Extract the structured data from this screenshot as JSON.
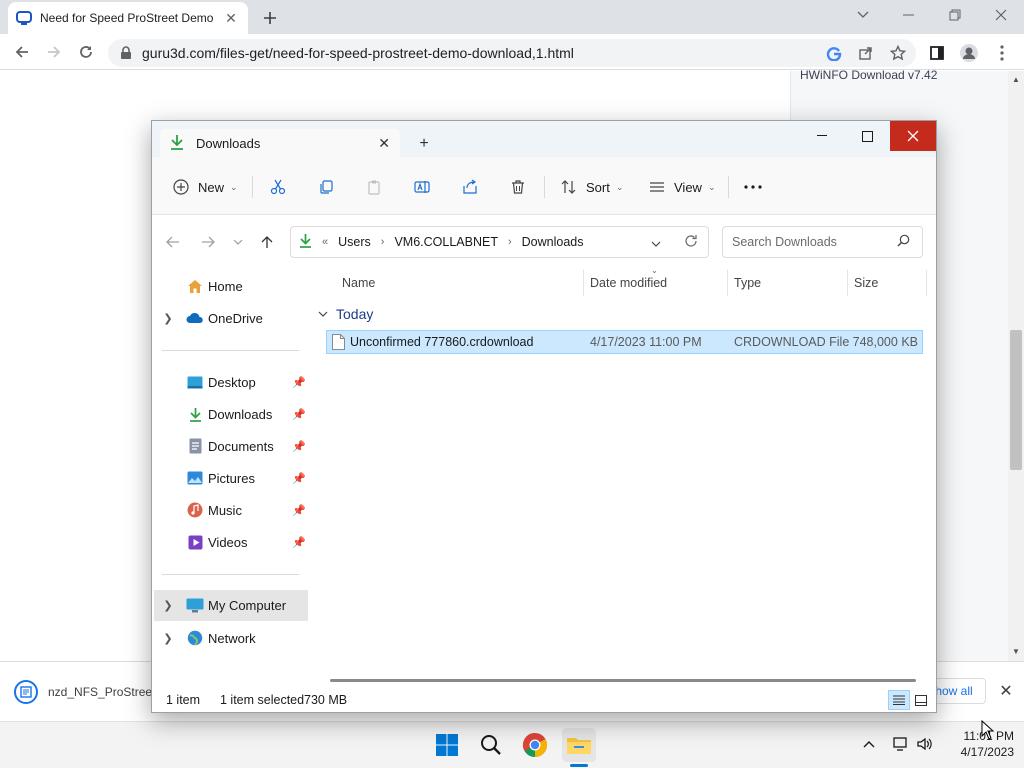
{
  "chrome": {
    "tab_title": "Need for Speed ProStreet Demo",
    "url": "guru3d.com/files-get/need-for-speed-prostreet-demo-download,1.html"
  },
  "page": {
    "sidebar_link": "HWiNFO Download v7.42"
  },
  "download_bar": {
    "filename": "nzd_NFS_ProStree",
    "show_all": "how all"
  },
  "explorer": {
    "tab_title": "Downloads",
    "commands": {
      "new": "New",
      "sort": "Sort",
      "view": "View"
    },
    "breadcrumb": {
      "prefix": "«",
      "items": [
        "Users",
        "VM6.COLLABNET",
        "Downloads"
      ]
    },
    "search_placeholder": "Search Downloads",
    "nav": {
      "home": "Home",
      "onedrive": "OneDrive",
      "desktop": "Desktop",
      "downloads": "Downloads",
      "documents": "Documents",
      "pictures": "Pictures",
      "music": "Music",
      "videos": "Videos",
      "my_computer": "My Computer",
      "network": "Network"
    },
    "columns": {
      "name": "Name",
      "date": "Date modified",
      "type": "Type",
      "size": "Size"
    },
    "group": "Today",
    "files": [
      {
        "name": "Unconfirmed 777860.crdownload",
        "date": "4/17/2023 11:00 PM",
        "type": "CRDOWNLOAD File",
        "size": "748,000 KB"
      }
    ],
    "status": {
      "count": "1 item",
      "selected": "1 item selected",
      "size": "730 MB"
    }
  },
  "taskbar": {
    "time": "11:01 PM",
    "date": "4/17/2023"
  },
  "colors": {
    "accent": "#0078d4",
    "close_red": "#c42b1c",
    "selection": "#cce8ff"
  }
}
